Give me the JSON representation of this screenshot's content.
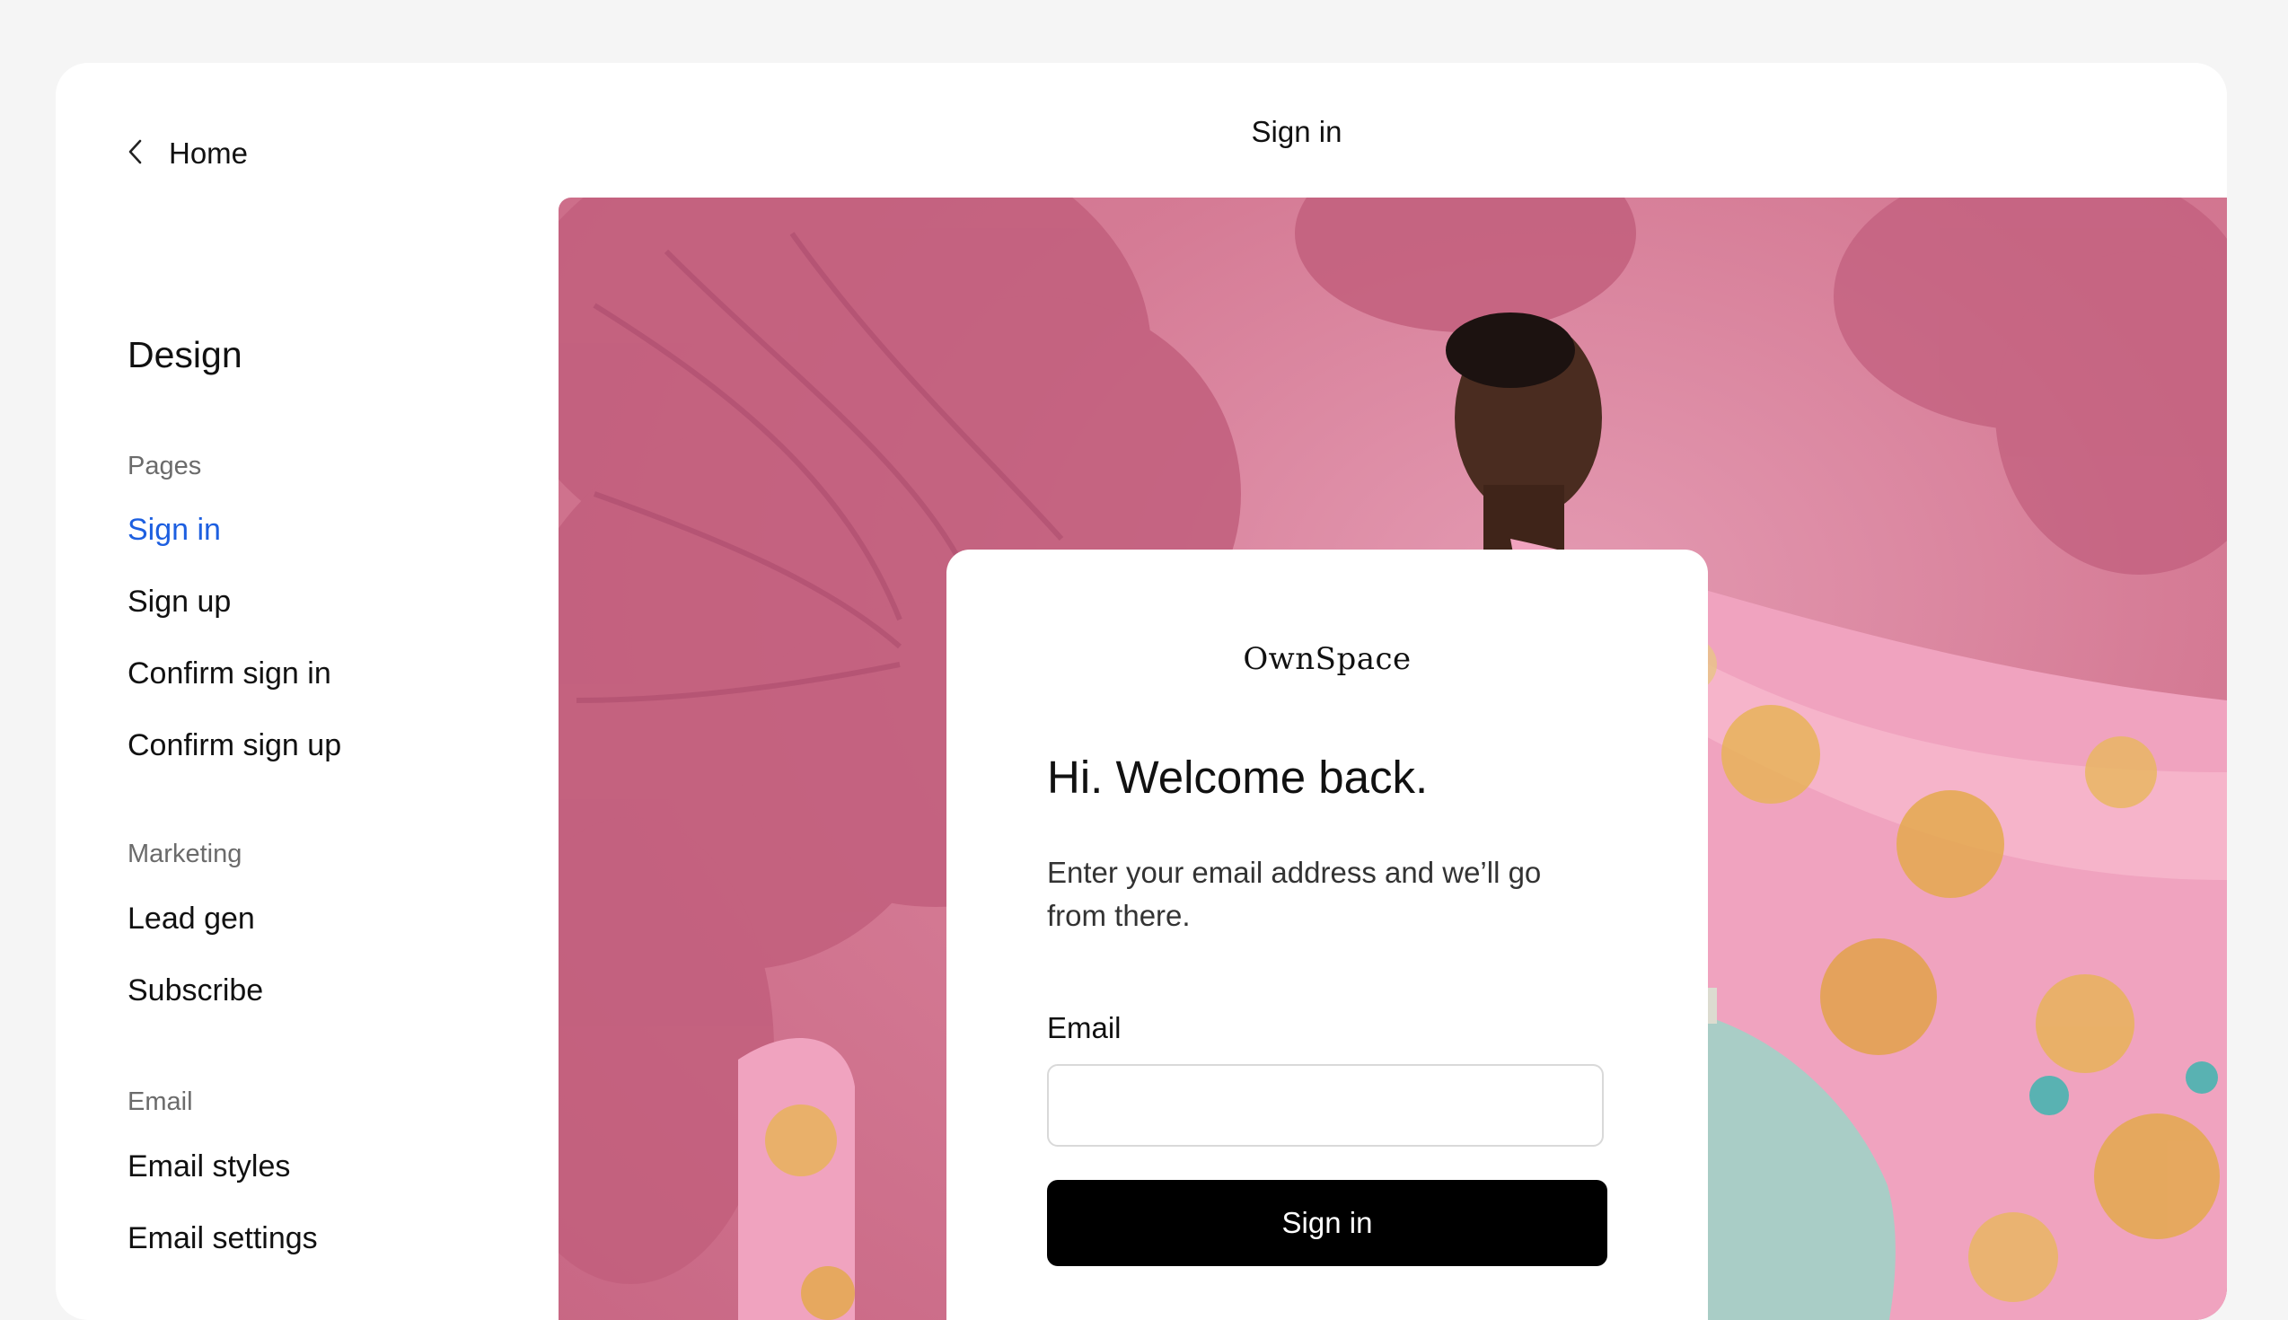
{
  "colors": {
    "page_bg": "#f5f5f5",
    "window_bg": "#ffffff",
    "accent": "#1d5fe0",
    "hero_pink": "#d57b95",
    "button_bg": "#000000"
  },
  "sidebar": {
    "back_label": "Home",
    "back_icon": "chevron-left-icon",
    "section_title": "Design",
    "groups": [
      {
        "label": "Pages",
        "items": [
          "Sign in",
          "Sign up",
          "Confirm sign in",
          "Confirm sign up"
        ],
        "active": "Sign in"
      },
      {
        "label": "Marketing",
        "items": [
          "Lead gen",
          "Subscribe"
        ]
      },
      {
        "label": "Email",
        "items": [
          "Email styles",
          "Email settings"
        ]
      }
    ]
  },
  "header": {
    "title": "Sign in"
  },
  "card": {
    "logo": "OwnSpace",
    "heading": "Hi. Welcome back.",
    "subtitle": "Enter your email address and we’ll go from there.",
    "email_label": "Email",
    "email_value": "",
    "button_label": "Sign in"
  }
}
